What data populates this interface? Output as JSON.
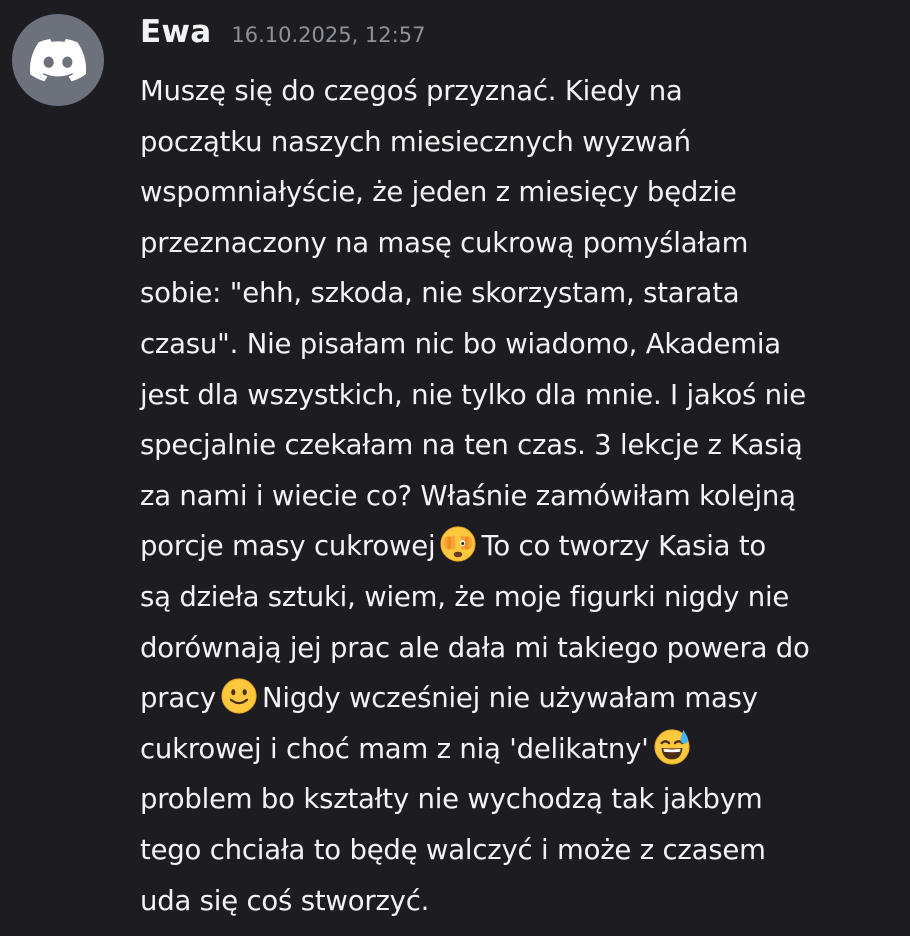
{
  "message": {
    "author": "Ewa",
    "timestamp": "16.10.2025, 12:57",
    "avatar_icon": "discord-logo-icon",
    "lines": [
      {
        "text": "Muszę się do czegoś przyznać. Kiedy na"
      },
      {
        "text": "początku naszych miesiecznych wyzwań"
      },
      {
        "text": "wspomniałyście, że jeden z miesięcy będzie"
      },
      {
        "text": "przeznaczony na masę cukrową pomyślałam"
      },
      {
        "text": "sobie: \"ehh, szkoda, nie skorzystam, starata"
      },
      {
        "text": "czasu\". Nie pisałam nic bo wiadomo, Akademia"
      },
      {
        "text": "jest dla wszystkich, nie tylko dla mnie. I jakoś nie"
      },
      {
        "text": "specjalnie czekałam na ten czas. 3 lekcje z Kasią"
      },
      {
        "text": "za nami i wiecie co? Właśnie zamówiłam kolejną"
      },
      {
        "before": "porcje masy cukrowej",
        "emoji": "face-with-peeking-eye-emoji-icon",
        "after": "To co tworzy Kasia to"
      },
      {
        "text": "są dzieła sztuki, wiem, że moje figurki nigdy nie"
      },
      {
        "text": "dorównają jej prac ale dała mi takiego powera do"
      },
      {
        "before": "pracy",
        "emoji": "slightly-smiling-face-emoji-icon",
        "after": "Nigdy wcześniej nie używałam masy"
      },
      {
        "before": "cukrowej i choć mam z nią 'delikatny'",
        "emoji": "grinning-face-with-sweat-emoji-icon",
        "after": ""
      },
      {
        "text": "problem bo kształty nie wychodzą tak jakbym"
      },
      {
        "text": "tego chciała to będę walczyć i może z czasem"
      },
      {
        "text": "uda się coś stworzyć."
      }
    ]
  },
  "colors": {
    "background": "#1c1c21",
    "avatar_bg": "#6d717c",
    "text": "#f2f3f5",
    "timestamp": "#8e9199",
    "emoji_yellow": "#ffc83d"
  }
}
